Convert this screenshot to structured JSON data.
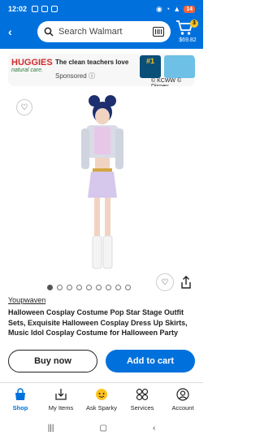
{
  "status": {
    "time": "12:02",
    "battery": "14"
  },
  "search": {
    "placeholder": "Search Walmart"
  },
  "cart": {
    "count": "3",
    "total": "$69.82"
  },
  "ad": {
    "brand": "HUGGIES",
    "brand_sub": "natural care.",
    "tagline": "The clean teachers love",
    "sponsored": "Sponsored",
    "promo": "#1",
    "credit": "© KCWW © Disney"
  },
  "product": {
    "seller": "Youpwaven",
    "title": "Halloween Cosplay Costume Pop Star Stage Outfit Sets, Exquisite Halloween Cosplay Dress Up Skirts, Music Idol Cosplay Costume for Halloween Party",
    "image_count": 9,
    "active_image": 1
  },
  "actions": {
    "buy_now": "Buy now",
    "add_to_cart": "Add to cart"
  },
  "tabs": [
    {
      "label": "Shop",
      "icon": "shop-icon",
      "active": true
    },
    {
      "label": "My Items",
      "icon": "my-items-icon",
      "active": false
    },
    {
      "label": "Ask Sparky",
      "icon": "sparky-icon",
      "active": false
    },
    {
      "label": "Services",
      "icon": "services-icon",
      "active": false
    },
    {
      "label": "Account",
      "icon": "account-icon",
      "active": false
    }
  ],
  "colors": {
    "brand": "#0071dc",
    "accent": "#ffc220"
  }
}
